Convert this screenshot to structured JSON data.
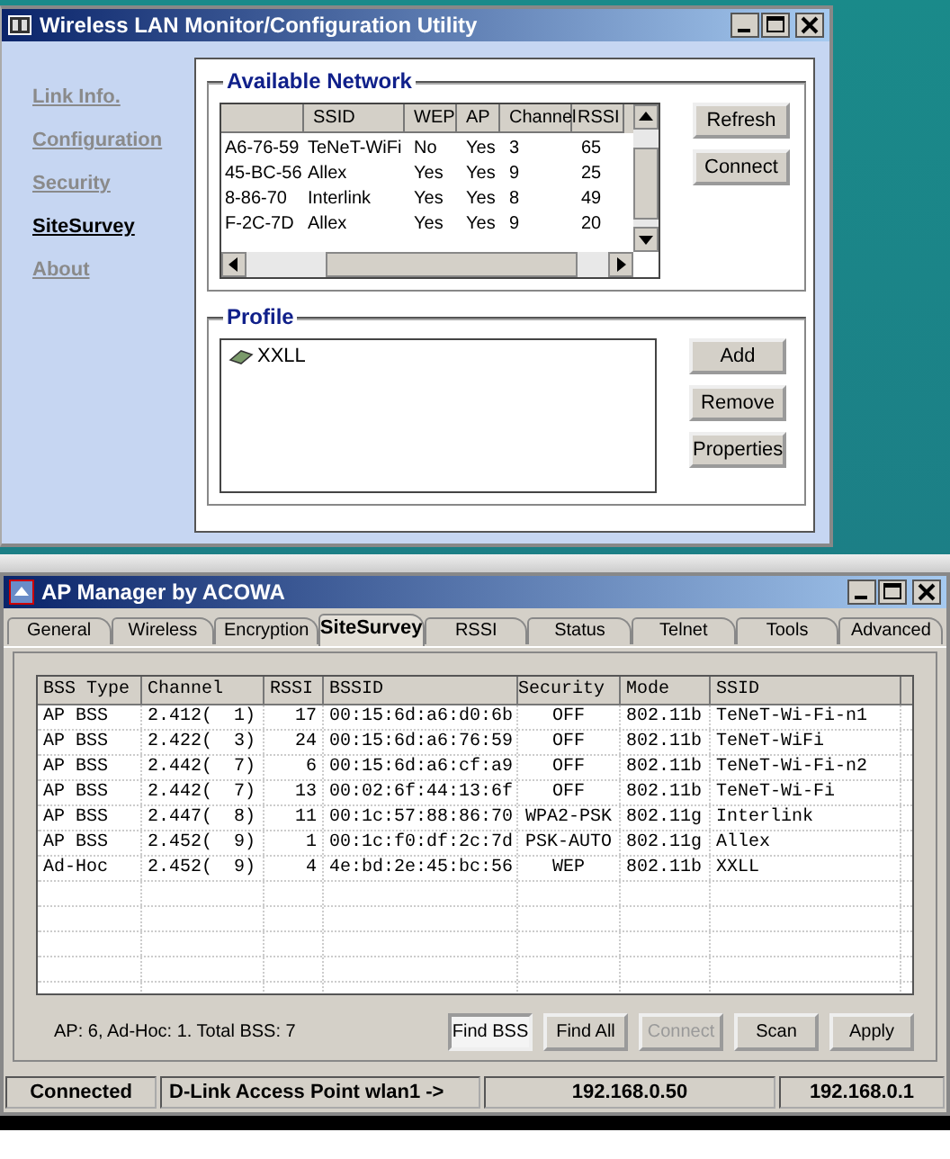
{
  "wlan_window": {
    "title": "Wireless LAN Monitor/Configuration Utility",
    "sidebar": {
      "items": [
        {
          "label": "Link Info.",
          "selected": false
        },
        {
          "label": "Configuration",
          "selected": false
        },
        {
          "label": "Security",
          "selected": false
        },
        {
          "label": "SiteSurvey",
          "selected": true
        },
        {
          "label": "About",
          "selected": false
        }
      ]
    },
    "available_network": {
      "title": "Available Network",
      "columns": [
        "",
        "SSID",
        "WEP",
        "AP",
        "Channel",
        "RSSI"
      ],
      "rows": [
        [
          "A6-76-59",
          "TeNeT-WiFi",
          "No",
          "Yes",
          "3",
          "65"
        ],
        [
          "45-BC-56",
          "Allex",
          "Yes",
          "Yes",
          "9",
          "25"
        ],
        [
          "8-86-70",
          "Interlink",
          "Yes",
          "Yes",
          "8",
          "49"
        ],
        [
          "F-2C-7D",
          "Allex",
          "Yes",
          "Yes",
          "9",
          "20"
        ]
      ],
      "buttons": [
        "Refresh",
        "Connect"
      ]
    },
    "profile": {
      "title": "Profile",
      "items": [
        "XXLL"
      ],
      "buttons": [
        "Add",
        "Remove",
        "Properties"
      ]
    }
  },
  "ap_manager": {
    "title": "AP Manager by ACOWA",
    "tabs": [
      {
        "label": "General",
        "selected": false
      },
      {
        "label": "Wireless",
        "selected": false
      },
      {
        "label": "Encryption",
        "selected": false
      },
      {
        "label": "SiteSurvey",
        "selected": true
      },
      {
        "label": "RSSI",
        "selected": false
      },
      {
        "label": "Status",
        "selected": false
      },
      {
        "label": "Telnet",
        "selected": false
      },
      {
        "label": "Tools",
        "selected": false
      },
      {
        "label": "Advanced",
        "selected": false
      }
    ],
    "table": {
      "columns": [
        "BSS Type",
        "Channel",
        "RSSI",
        "BSSID",
        "Security",
        "Mode",
        "SSID"
      ],
      "rows": [
        [
          "AP BSS",
          "2.412(  1)",
          "17",
          "00:15:6d:a6:d0:6b",
          "OFF",
          "802.11b",
          "TeNeT-Wi-Fi-n1"
        ],
        [
          "AP BSS",
          "2.422(  3)",
          "24",
          "00:15:6d:a6:76:59",
          "OFF",
          "802.11b",
          "TeNeT-WiFi"
        ],
        [
          "AP BSS",
          "2.442(  7)",
          "6",
          "00:15:6d:a6:cf:a9",
          "OFF",
          "802.11b",
          "TeNeT-Wi-Fi-n2"
        ],
        [
          "AP BSS",
          "2.442(  7)",
          "13",
          "00:02:6f:44:13:6f",
          "OFF",
          "802.11b",
          "TeNeT-Wi-Fi"
        ],
        [
          "AP BSS",
          "2.447(  8)",
          "11",
          "00:1c:57:88:86:70",
          "WPA2-PSK",
          "802.11g",
          "Interlink"
        ],
        [
          "AP BSS",
          "2.452(  9)",
          "1",
          "00:1c:f0:df:2c:7d",
          "PSK-AUTO",
          "802.11g",
          "Allex"
        ],
        [
          "Ad-Hoc",
          "2.452(  9)",
          "4",
          "4e:bd:2e:45:bc:56",
          "WEP",
          "802.11b",
          "XXLL"
        ]
      ]
    },
    "summary": "AP: 6, Ad-Hoc: 1. Total BSS: 7",
    "buttons": [
      {
        "label": "Find BSS",
        "pressed": true,
        "disabled": false
      },
      {
        "label": "Find All",
        "pressed": false,
        "disabled": false
      },
      {
        "label": "Connect",
        "pressed": false,
        "disabled": true
      },
      {
        "label": "Scan",
        "pressed": false,
        "disabled": false
      },
      {
        "label": "Apply",
        "pressed": false,
        "disabled": false
      }
    ],
    "status_bar": [
      "Connected",
      "D-Link Access Point wlan1 ->",
      "192.168.0.50",
      "192.168.0.1"
    ]
  }
}
